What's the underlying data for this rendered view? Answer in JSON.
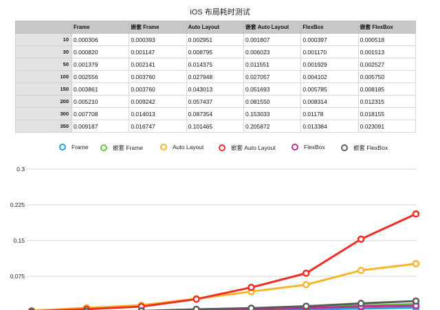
{
  "chart_data": {
    "type": "line",
    "title": "iOS 布局耗时测试",
    "categories": [
      "10",
      "30",
      "50",
      "100",
      "150",
      "200",
      "300",
      "350"
    ],
    "series": [
      {
        "name": "Frame",
        "color": "#1ea1e8",
        "values": [
          0.000306,
          0.00082,
          0.001379,
          0.002556,
          0.003861,
          0.00521,
          0.007708,
          0.009187
        ]
      },
      {
        "name": "嵌套 Frame",
        "color": "#63c44a",
        "values": [
          0.000393,
          0.001147,
          0.002141,
          0.00376,
          0.00376,
          0.009242,
          0.014013,
          0.016747
        ]
      },
      {
        "name": "Auto Layout",
        "color": "#f7b528",
        "values": [
          0.002951,
          0.008795,
          0.014375,
          0.027948,
          0.043013,
          0.057437,
          0.087354,
          0.101465
        ]
      },
      {
        "name": "嵌套 Auto Layout",
        "color": "#f02d24",
        "values": [
          0.001807,
          0.006023,
          0.011551,
          0.027057,
          0.051693,
          0.08155,
          0.153033,
          0.205872
        ]
      },
      {
        "name": "FlexBox",
        "color": "#c22e8e",
        "values": [
          0.000397,
          0.00117,
          0.001929,
          0.004102,
          0.005785,
          0.008314,
          0.01178,
          0.013384
        ]
      },
      {
        "name": "嵌套 FlexBox",
        "color": "#5b5b5b",
        "values": [
          0.000518,
          0.001513,
          0.002527,
          0.00575,
          0.008185,
          0.012315,
          0.018155,
          0.023091
        ]
      }
    ],
    "table": {
      "headers": [
        "",
        "Frame",
        "嵌套 Frame",
        "Auto Layout",
        "嵌套 Auto Layout",
        "FlexBox",
        "嵌套 FlexBox"
      ],
      "rows": [
        [
          "10",
          "0.000306",
          "0.000393",
          "0.002951",
          "0.001807",
          "0.000397",
          "0.000518"
        ],
        [
          "30",
          "0.000820",
          "0.001147",
          "0.008795",
          "0.006023",
          "0.001170",
          "0.001513"
        ],
        [
          "50",
          "0.001379",
          "0.002141",
          "0.014375",
          "0.011551",
          "0.001929",
          "0.002527"
        ],
        [
          "100",
          "0.002556",
          "0.003760",
          "0.027948",
          "0.027057",
          "0.004102",
          "0.005750"
        ],
        [
          "150",
          "0.003861",
          "0.003760",
          "0.043013",
          "0.051693",
          "0.005785",
          "0.008185"
        ],
        [
          "200",
          "0.005210",
          "0.009242",
          "0.057437",
          "0.081550",
          "0.008314",
          "0.012315"
        ],
        [
          "300",
          "0.007708",
          "0.014013",
          "0.087354",
          "0.153033",
          "0.01178",
          "0.018155"
        ],
        [
          "350",
          "0.009187",
          "0.016747",
          "0.101465",
          "0.205872",
          "0.013384",
          "0.023091"
        ]
      ]
    },
    "yticks": [
      "0.3",
      "0.225",
      "0.15",
      "0.075"
    ],
    "ylim": [
      0,
      0.3
    ],
    "grid": true,
    "legend": "top"
  }
}
